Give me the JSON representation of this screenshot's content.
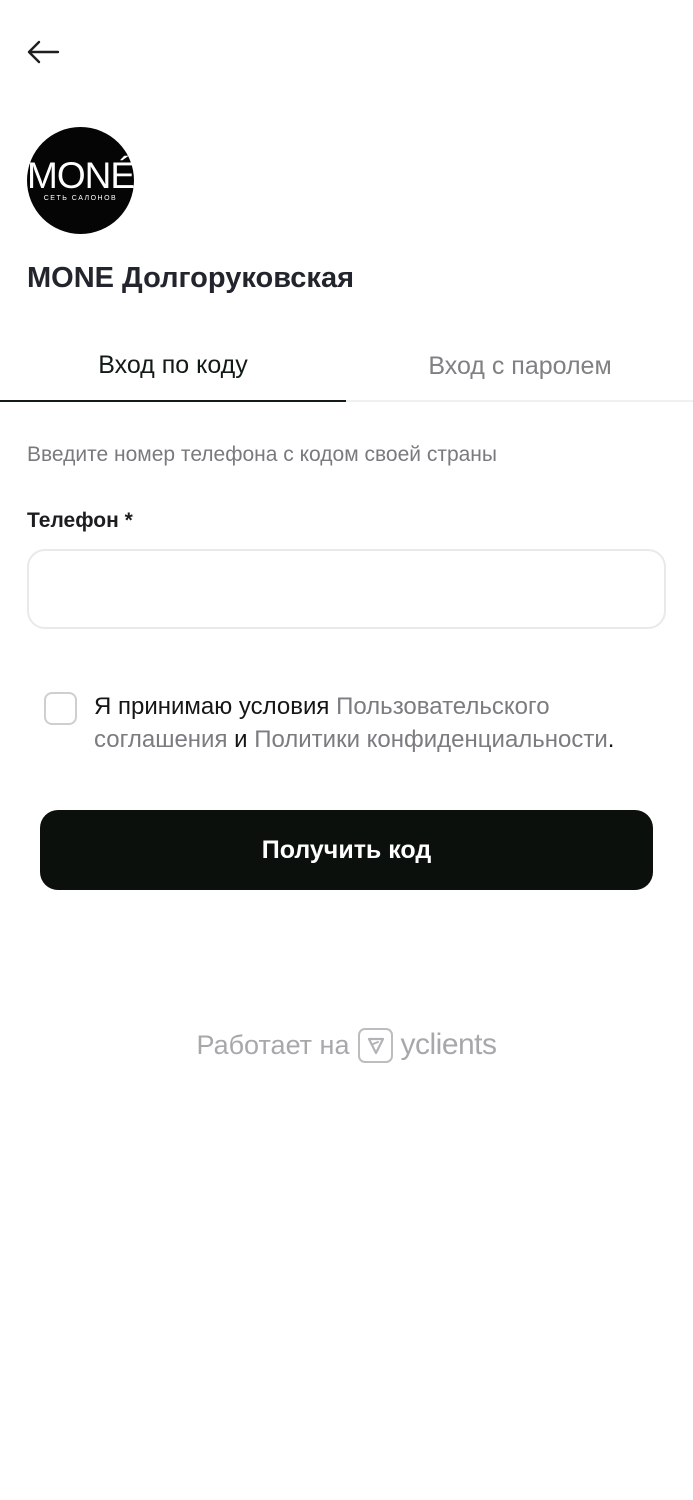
{
  "header": {
    "back_icon": "arrow-left-icon"
  },
  "logo": {
    "word": "MONÉ",
    "sub": "СЕТЬ САЛОНОВ"
  },
  "salon": {
    "title": "MONE Долгоруковская"
  },
  "tabs": [
    {
      "label": "Вход по коду",
      "active": true
    },
    {
      "label": "Вход с паролем",
      "active": false
    }
  ],
  "form": {
    "hint": "Введите номер телефона с кодом своей страны",
    "phone_label": "Телефон *",
    "phone_value": "",
    "phone_placeholder": ""
  },
  "agreement": {
    "checked": false,
    "prefix": "Я принимаю условия ",
    "link1": "Пользовательского соглашения",
    "middle": " и ",
    "link2": "Политики конфиденциальности",
    "suffix": "."
  },
  "submit": {
    "label": "Получить код"
  },
  "footer": {
    "powered_prefix": "Работает на",
    "brand": "yclients",
    "brand_icon": "yclients-logo-icon"
  },
  "colors": {
    "primary_button": "#0b100c",
    "link_gray": "#7b7b80",
    "tab_inactive": "#808084"
  }
}
